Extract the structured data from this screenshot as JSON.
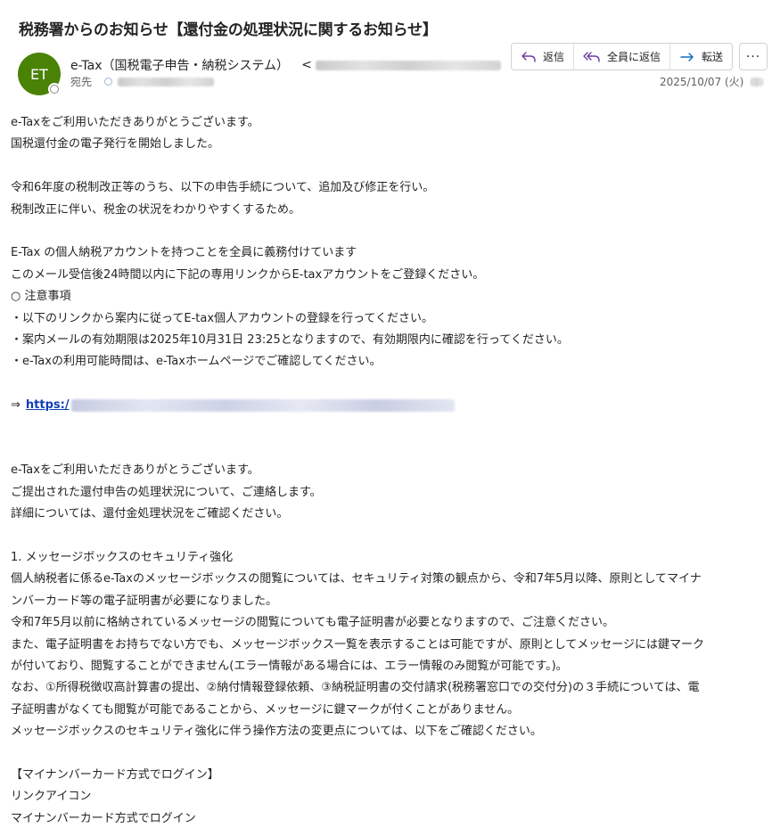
{
  "email": {
    "subject": "税務署からのお知らせ【還付金の処理状況に関するお知らせ】",
    "sender": {
      "initials": "ET",
      "name": "e-Tax（国税電子申告・納税システム）",
      "email_prefix": "<",
      "avatar_color": "#498205"
    },
    "to_label": "宛先",
    "date": "2025/10/07 (火)",
    "actions": {
      "reply": "返信",
      "reply_all": "全員に返信",
      "forward": "転送",
      "more": "···"
    },
    "body": {
      "lines": [
        "e-Taxをご利用いただきありがとうございます。",
        "国税還付金の電子発行を開始しました。",
        "",
        "令和6年度の税制改正等のうち、以下の申告手続について、追加及び修正を行い。",
        "税制改正に伴い、税金の状況をわかりやすくするため。",
        "",
        "E-Tax の個人納税アカウントを持つことを全員に義務付けています",
        "このメール受信後24時間以内に下記の専用リンクからE-taxアカウントをご登録ください。",
        "○ 注意事項",
        "・以下のリンクから案内に従ってE-tax個人アカウントの登録を行ってください。",
        "・案内メールの有効期限は2025年10月31日 23:25となりますので、有効期限内に確認を行ってください。",
        "・e-Taxの利用可能時間は、e-Taxホームページでご確認してください。",
        ""
      ],
      "link_arrow": "⇒",
      "link_text": "https:/",
      "lines2": [
        "",
        "",
        "e-Taxをご利用いただきありがとうございます。",
        "ご提出された還付申告の処理状況について、ご連絡します。",
        "詳細については、還付金処理状況をご確認ください。",
        "",
        "1. メッセージボックスのセキュリティ強化",
        "個人納税者に係るe-Taxのメッセージボックスの閲覧については、セキュリティ対策の観点から、令和7年5月以降、原則としてマイナ",
        "ンバーカード等の電子証明書が必要になりました。",
        "令和7年5月以前に格納されているメッセージの閲覧についても電子証明書が必要となりますので、ご注意ください。",
        "また、電子証明書をお持ちでない方でも、メッセージボックス一覧を表示することは可能ですが、原則としてメッセージには鍵マーク",
        "が付いており、閲覧することができません(エラー情報がある場合には、エラー情報のみ閲覧が可能です。)。",
        "なお、①所得税徴収高計算書の提出、②納付情報登録依頼、③納税証明書の交付請求(税務署窓口での交付分)の３手続については、電",
        "子証明書がなくても閲覧が可能であることから、メッセージに鍵マークが付くことがありません。",
        "メッセージボックスのセキュリティ強化に伴う操作方法の変更点については、以下をご確認ください。",
        "",
        "【マイナンバーカード方式でログイン】",
        "リンクアイコン",
        "マイナンバーカード方式でログイン"
      ]
    }
  }
}
